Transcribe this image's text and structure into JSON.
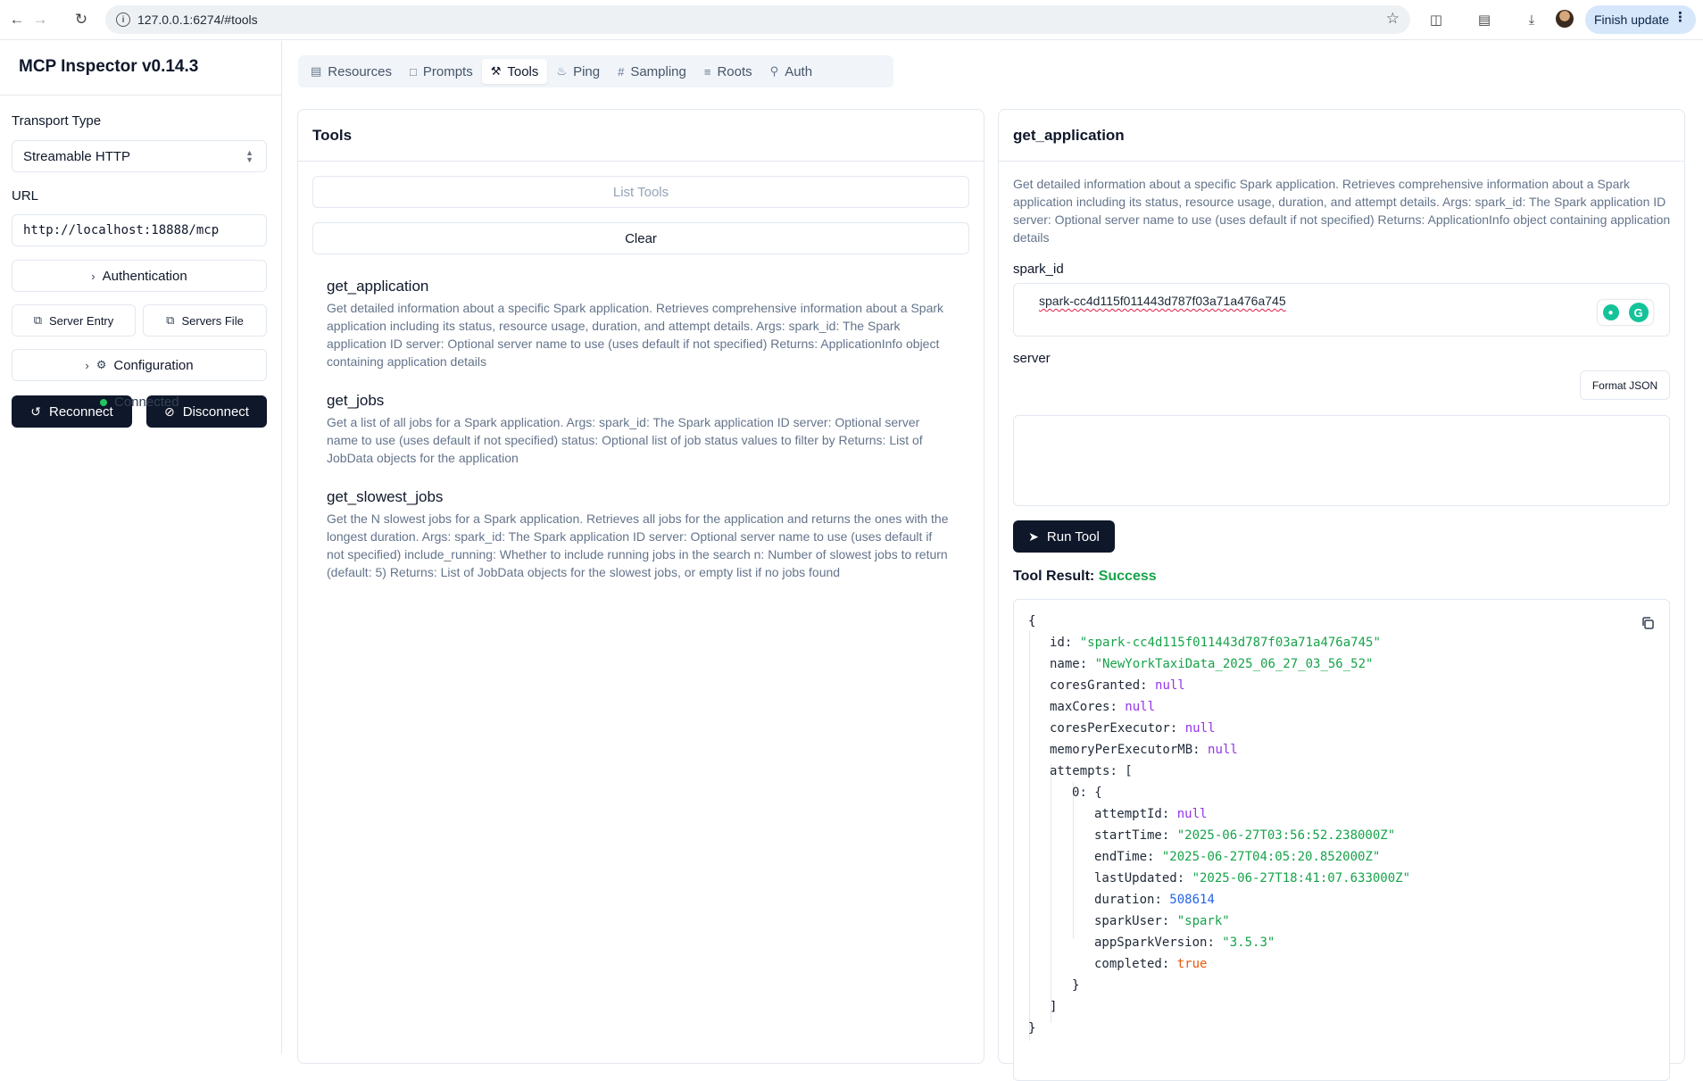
{
  "browser": {
    "url": "127.0.0.1:6274/#tools",
    "finish_update": "Finish update"
  },
  "sidebar": {
    "app_title": "MCP Inspector v0.14.3",
    "transport_label": "Transport Type",
    "transport_value": "Streamable HTTP",
    "url_label": "URL",
    "url_value": "http://localhost:18888/mcp",
    "authentication": "Authentication",
    "server_entry": "Server Entry",
    "servers_file": "Servers File",
    "configuration": "Configuration",
    "reconnect": "Reconnect",
    "disconnect": "Disconnect",
    "status": "Connected"
  },
  "tabs": [
    {
      "label": "Resources",
      "icon": "file-copy-icon"
    },
    {
      "label": "Prompts",
      "icon": "message-icon"
    },
    {
      "label": "Tools",
      "icon": "hammer-icon",
      "active": true
    },
    {
      "label": "Ping",
      "icon": "bell-icon"
    },
    {
      "label": "Sampling",
      "icon": "hash-icon"
    },
    {
      "label": "Roots",
      "icon": "folder-tree-icon"
    },
    {
      "label": "Auth",
      "icon": "key-icon"
    }
  ],
  "tools_panel": {
    "title": "Tools",
    "list_tools": "List Tools",
    "clear": "Clear",
    "items": [
      {
        "name": "get_application",
        "description": "Get detailed information about a specific Spark application. Retrieves comprehensive information about a Spark application including its status, resource usage, duration, and attempt details. Args: spark_id: The Spark application ID server: Optional server name to use (uses default if not specified) Returns: ApplicationInfo object containing application details"
      },
      {
        "name": "get_jobs",
        "description": "Get a list of all jobs for a Spark application. Args: spark_id: The Spark application ID server: Optional server name to use (uses default if not specified) status: Optional list of job status values to filter by Returns: List of JobData objects for the application"
      },
      {
        "name": "get_slowest_jobs",
        "description": "Get the N slowest jobs for a Spark application. Retrieves all jobs for the application and returns the ones with the longest duration. Args: spark_id: The Spark application ID server: Optional server name to use (uses default if not specified) include_running: Whether to include running jobs in the search n: Number of slowest jobs to return (default: 5) Returns: List of JobData objects for the slowest jobs, or empty list if no jobs found"
      }
    ]
  },
  "detail": {
    "title": "get_application",
    "description": "Get detailed information about a specific Spark application. Retrieves comprehensive information about a Spark application including its status, resource usage, duration, and attempt details. Args: spark_id: The Spark application ID server: Optional server name to use (uses default if not specified) Returns: ApplicationInfo object containing application details",
    "spark_id_label": "spark_id",
    "spark_id_value": "spark-cc4d115f011443d787f03a71a476a745",
    "server_label": "server",
    "server_value": "",
    "format_json": "Format JSON",
    "run_tool": "Run Tool",
    "result_label": "Tool Result:",
    "result_status": "Success"
  },
  "result_json": {
    "open_brace": "{",
    "close_brace": "}",
    "lines": [
      {
        "key": "id",
        "value": "\"spark-cc4d115f011443d787f03a71a476a745\"",
        "type": "string"
      },
      {
        "key": "name",
        "value": "\"NewYorkTaxiData_2025_06_27_03_56_52\"",
        "type": "string"
      },
      {
        "key": "coresGranted",
        "value": "null",
        "type": "null"
      },
      {
        "key": "maxCores",
        "value": "null",
        "type": "null"
      },
      {
        "key": "coresPerExecutor",
        "value": "null",
        "type": "null"
      },
      {
        "key": "memoryPerExecutorMB",
        "value": "null",
        "type": "null"
      },
      {
        "key": "attempts",
        "value": "[",
        "type": "punct"
      }
    ],
    "attempt_index": "0",
    "attempt_open": "{",
    "attempt_lines": [
      {
        "key": "attemptId",
        "value": "null",
        "type": "null"
      },
      {
        "key": "startTime",
        "value": "\"2025-06-27T03:56:52.238000Z\"",
        "type": "string"
      },
      {
        "key": "endTime",
        "value": "\"2025-06-27T04:05:20.852000Z\"",
        "type": "string"
      },
      {
        "key": "lastUpdated",
        "value": "\"2025-06-27T18:41:07.633000Z\"",
        "type": "string"
      },
      {
        "key": "duration",
        "value": "508614",
        "type": "number"
      },
      {
        "key": "sparkUser",
        "value": "\"spark\"",
        "type": "string"
      },
      {
        "key": "appSparkVersion",
        "value": "\"3.5.3\"",
        "type": "string"
      },
      {
        "key": "completed",
        "value": "true",
        "type": "bool"
      }
    ],
    "attempt_close": "}",
    "attempts_close": "]"
  }
}
